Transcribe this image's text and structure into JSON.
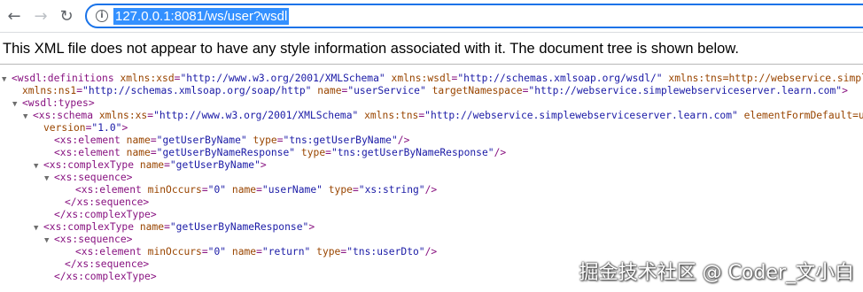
{
  "browser": {
    "back_icon": "←",
    "forward_icon": "→",
    "reload_icon": "↻",
    "info_icon": "i",
    "url": "127.0.0.1:8081/ws/user?wsdl"
  },
  "notice": "This XML file does not appear to have any style information associated with it. The document tree is shown below.",
  "xml_lines": [
    {
      "indent": 0,
      "tri": "▼",
      "text": "<wsdl:definitions xmlns:xsd=\"http://www.w3.org/2001/XMLSchema\" xmlns:wsdl=\"http://schemas.xmlsoap.org/wsdl/\" xmlns:tns=\"http://webservice.simplewe"
    },
    {
      "indent": 1,
      "tri": "",
      "text": "xmlns:ns1=\"http://schemas.xmlsoap.org/soap/http\" name=\"userService\" targetNamespace=\"http://webservice.simplewebserviceserver.learn.com\">"
    },
    {
      "indent": 1,
      "tri": "▼",
      "text": "<wsdl:types>"
    },
    {
      "indent": 2,
      "tri": "▼",
      "text": "<xs:schema xmlns:xs=\"http://www.w3.org/2001/XMLSchema\" xmlns:tns=\"http://webservice.simplewebserviceserver.learn.com\" elementFormDefault=\"unqu"
    },
    {
      "indent": 3,
      "tri": "",
      "text": "version=\"1.0\">"
    },
    {
      "indent": 4,
      "tri": "",
      "text": "<xs:element name=\"getUserByName\" type=\"tns:getUserByName\"/>"
    },
    {
      "indent": 4,
      "tri": "",
      "text": "<xs:element name=\"getUserByNameResponse\" type=\"tns:getUserByNameResponse\"/>"
    },
    {
      "indent": 3,
      "tri": "▼",
      "text": "<xs:complexType name=\"getUserByName\">"
    },
    {
      "indent": 4,
      "tri": "▼",
      "text": "<xs:sequence>"
    },
    {
      "indent": 6,
      "tri": "",
      "text": "<xs:element minOccurs=\"0\" name=\"userName\" type=\"xs:string\"/>"
    },
    {
      "indent": 5,
      "tri": "",
      "text": "</xs:sequence>"
    },
    {
      "indent": 4,
      "tri": "",
      "text": "</xs:complexType>"
    },
    {
      "indent": 3,
      "tri": "▼",
      "text": "<xs:complexType name=\"getUserByNameResponse\">"
    },
    {
      "indent": 4,
      "tri": "▼",
      "text": "<xs:sequence>"
    },
    {
      "indent": 6,
      "tri": "",
      "text": "<xs:element minOccurs=\"0\" name=\"return\" type=\"tns:userDto\"/>"
    },
    {
      "indent": 5,
      "tri": "",
      "text": "</xs:sequence>"
    },
    {
      "indent": 4,
      "tri": "",
      "text": "</xs:complexType>"
    }
  ],
  "watermark": "掘金技术社区 @ Coder_文小白"
}
